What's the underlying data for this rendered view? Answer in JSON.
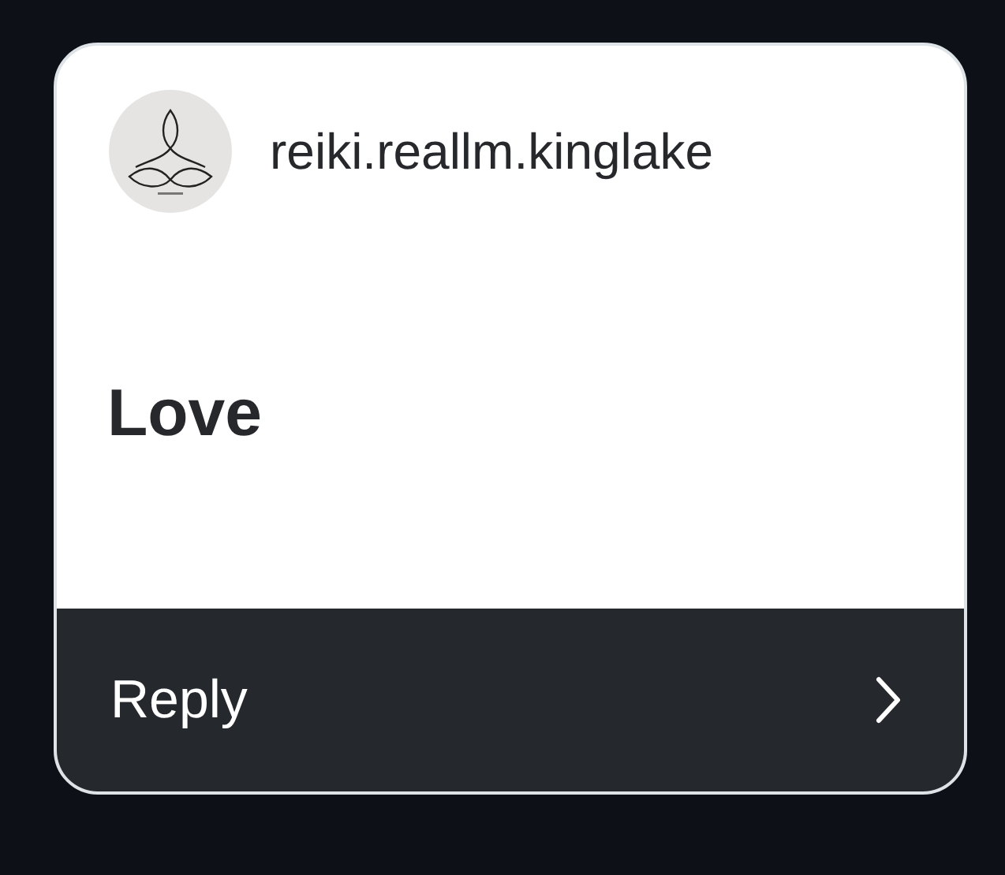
{
  "author": {
    "username": "reiki.reallm.kinglake"
  },
  "message": {
    "text": "Love"
  },
  "reply_bar": {
    "label": "Reply"
  }
}
